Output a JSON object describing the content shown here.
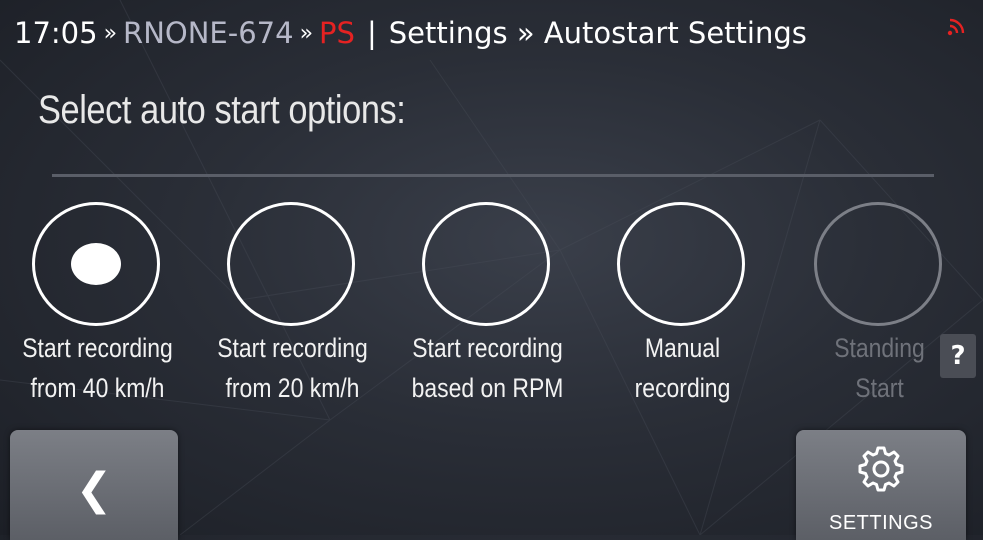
{
  "header": {
    "time": "17:05",
    "separator": "»",
    "device": "RNONE-674",
    "mode": "PS",
    "pipe": "|",
    "breadcrumb": "Settings » Autostart Settings",
    "mode_color": "#e52222",
    "signal_icon": "signal-icon"
  },
  "page": {
    "title": "Select auto start options:"
  },
  "options": [
    {
      "line1": "Start recording",
      "line2": "from 40 km/h",
      "selected": true,
      "enabled": true
    },
    {
      "line1": "Start recording",
      "line2": "from 20 km/h",
      "selected": false,
      "enabled": true
    },
    {
      "line1": "Start recording",
      "line2": "based on RPM",
      "selected": false,
      "enabled": true
    },
    {
      "line1": "Manual",
      "line2": "recording",
      "selected": false,
      "enabled": true
    },
    {
      "line1": "Standing",
      "line2": "Start",
      "selected": false,
      "enabled": false
    }
  ],
  "help": {
    "label": "?"
  },
  "footer": {
    "back_label": "❮",
    "settings_label": "SETTINGS",
    "settings_icon": "gear-icon"
  }
}
